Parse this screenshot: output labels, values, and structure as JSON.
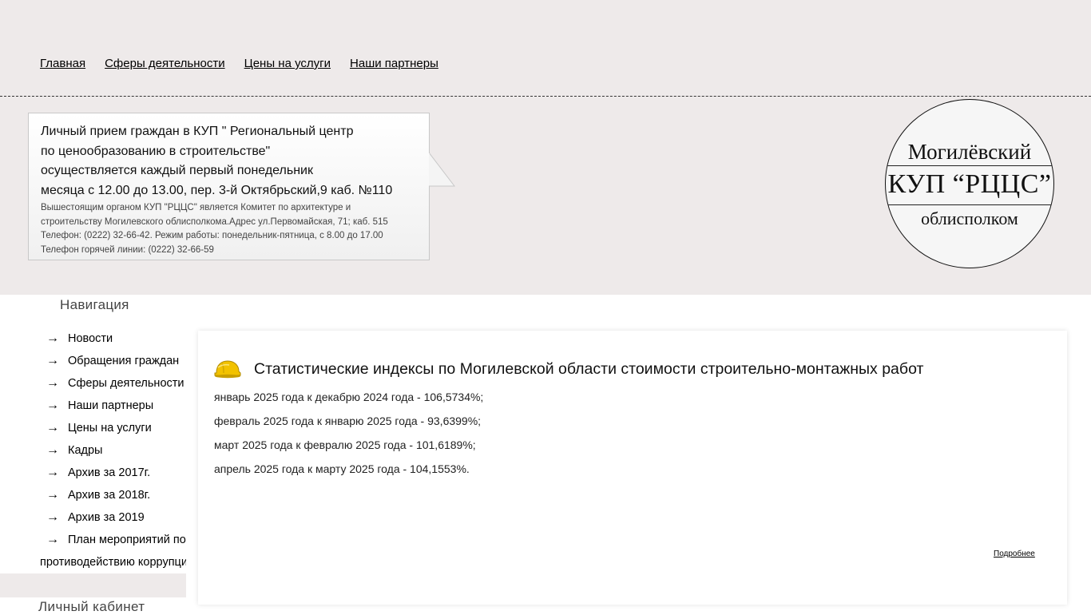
{
  "top_nav": [
    "Главная",
    "Сферы деятельности",
    "Цены на услуги",
    "Наши партнеры"
  ],
  "notice": {
    "lines": [
      "Личный прием граждан в КУП \" Региональный центр",
      "по ценообразованию в строительстве\"",
      "осуществляется каждый первый понедельник",
      "месяца с 12.00 до 13.00, пер. 3-й Октябрьский,9 каб. №110"
    ],
    "small_lines": [
      "Вышестоящим органом КУП \"РЦЦС\" является Комитет по архитектуре и",
      "строительству Могилевского облисполкома.Адрес ул.Первомайская, 71; каб. 515",
      "Телефон: (0222) 32-66-42. Режим работы: понедельник-пятница, с 8.00 до 17.00",
      "Телефон горячей линии: (0222) 32-66-59"
    ]
  },
  "logo": {
    "line1": "Могилёвский",
    "line2": "КУП “РЦЦС”",
    "line3": "облисполком"
  },
  "sidebar": {
    "title": "Навигация",
    "arrow": "→",
    "items": [
      "Новости",
      "Обращения граждан",
      "Сферы деятельности",
      "Наши партнеры",
      "Цены на услуги",
      "Кадры",
      "Архив за 2017г.",
      "Архив за 2018г.",
      "Архив за 2019"
    ],
    "last_item": {
      "line1": "План мероприятий по",
      "line2": "противодействию коррупции"
    },
    "title2": "Личный кабинет"
  },
  "article": {
    "title": "Статистические индексы по Могилевской области стоимости строительно-монтажных работ",
    "lines": [
      "январь 2025 года к декабрю 2024 года - 106,5734%;",
      "февраль 2025 года к январю 2025 года - 93,6399%;",
      "март 2025 года к февралю 2025 года - 101,6189%;",
      "апрель 2025 года к марту 2025 года - 104,1553%."
    ],
    "more_label": "Подробнее"
  },
  "colors": {
    "header_bg": "#eeeaea",
    "helmet": "#f2c200"
  }
}
